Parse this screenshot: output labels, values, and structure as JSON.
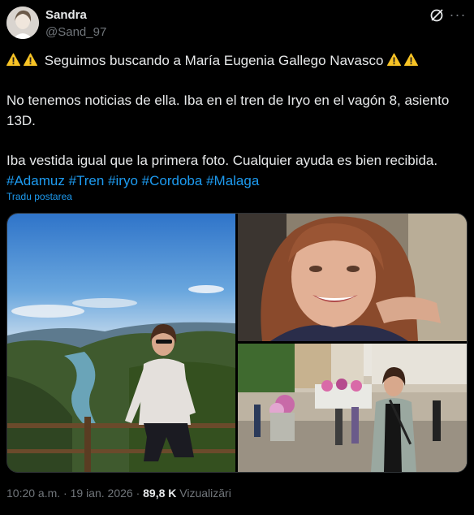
{
  "author": {
    "name": "Sandra",
    "handle": "@Sand_97"
  },
  "icons": {
    "warning": "warning-icon",
    "grok": "grok-icon",
    "more": "more-icon"
  },
  "post": {
    "line1_text": "Seguimos buscando a María Eugenia Gallego Navasco",
    "line2": "No tenemos noticias de ella. Iba en el tren de Iryo en el vagón 8, asiento",
    "line3": "13D.",
    "line4": "Iba vestida igual que la primera foto. Cualquier ayuda es bien recibida.",
    "hashtags": [
      "#Adamuz",
      "#Tren",
      "#iryo",
      "#Cordoba",
      "#Malaga"
    ]
  },
  "translate_label": "Tradu postarea",
  "meta": {
    "time": "10:20 a.m.",
    "separator": "·",
    "date": "19 ian. 2026",
    "views_count": "89,8 K",
    "views_label": "Vizualizări"
  },
  "colors": {
    "background": "#000000",
    "text": "#e7e9ea",
    "muted": "#71767b",
    "link": "#1d9bf0",
    "border": "#2f3336"
  }
}
